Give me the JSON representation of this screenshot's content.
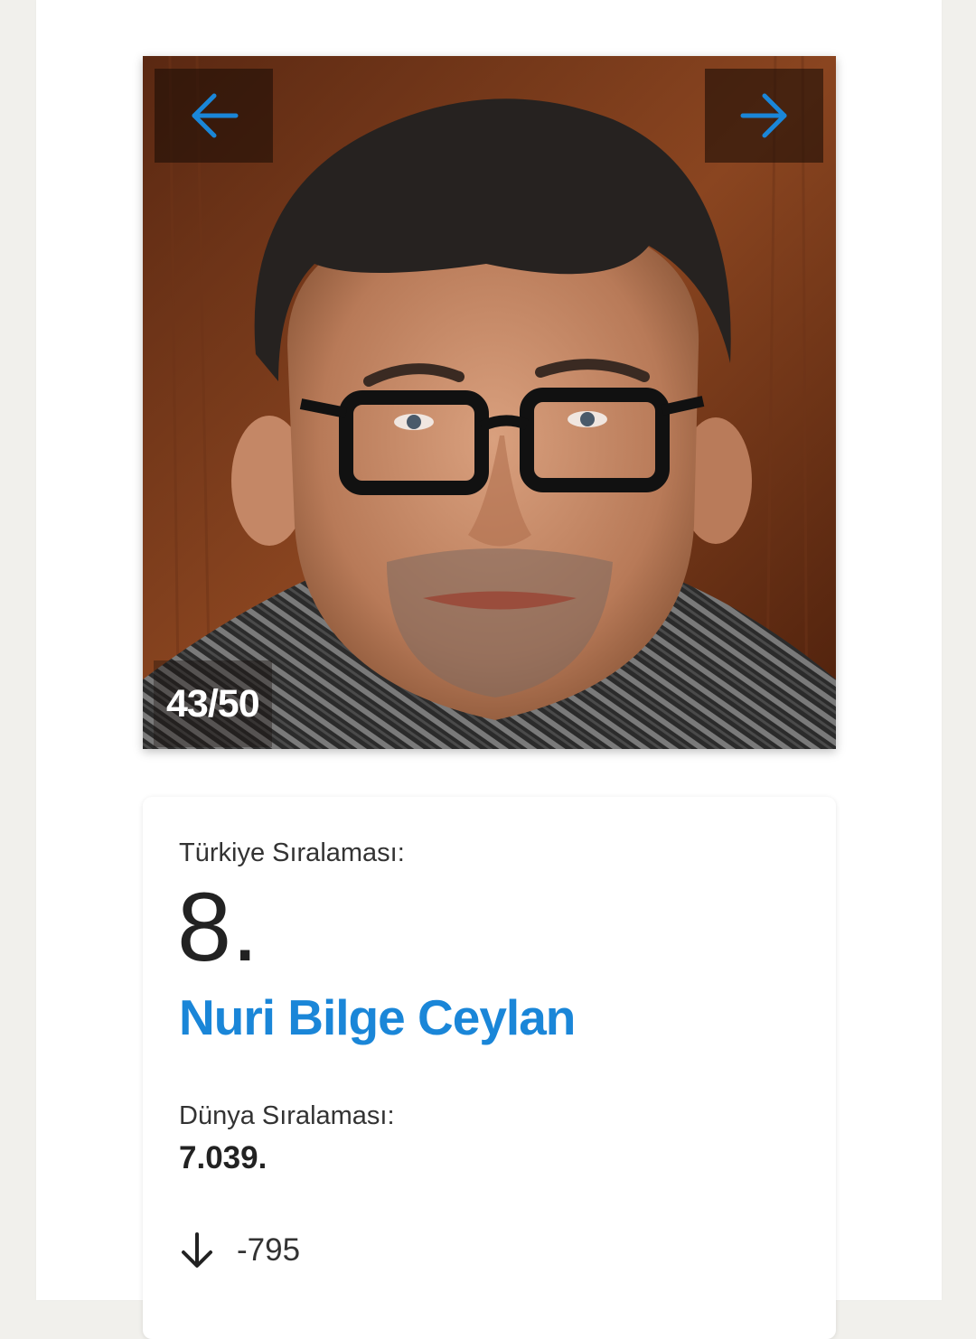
{
  "gallery": {
    "counter": "43/50",
    "prev_icon": "arrow-left-icon",
    "next_icon": "arrow-right-icon",
    "accent_color": "#1a86d8"
  },
  "profile": {
    "turkey_rank_label": "Türkiye Sıralaması:",
    "turkey_rank": "8.",
    "name": "Nuri Bilge Ceylan",
    "world_rank_label": "Dünya Sıralaması:",
    "world_rank": "7.039.",
    "change_icon": "arrow-down-icon",
    "change": "-795"
  }
}
